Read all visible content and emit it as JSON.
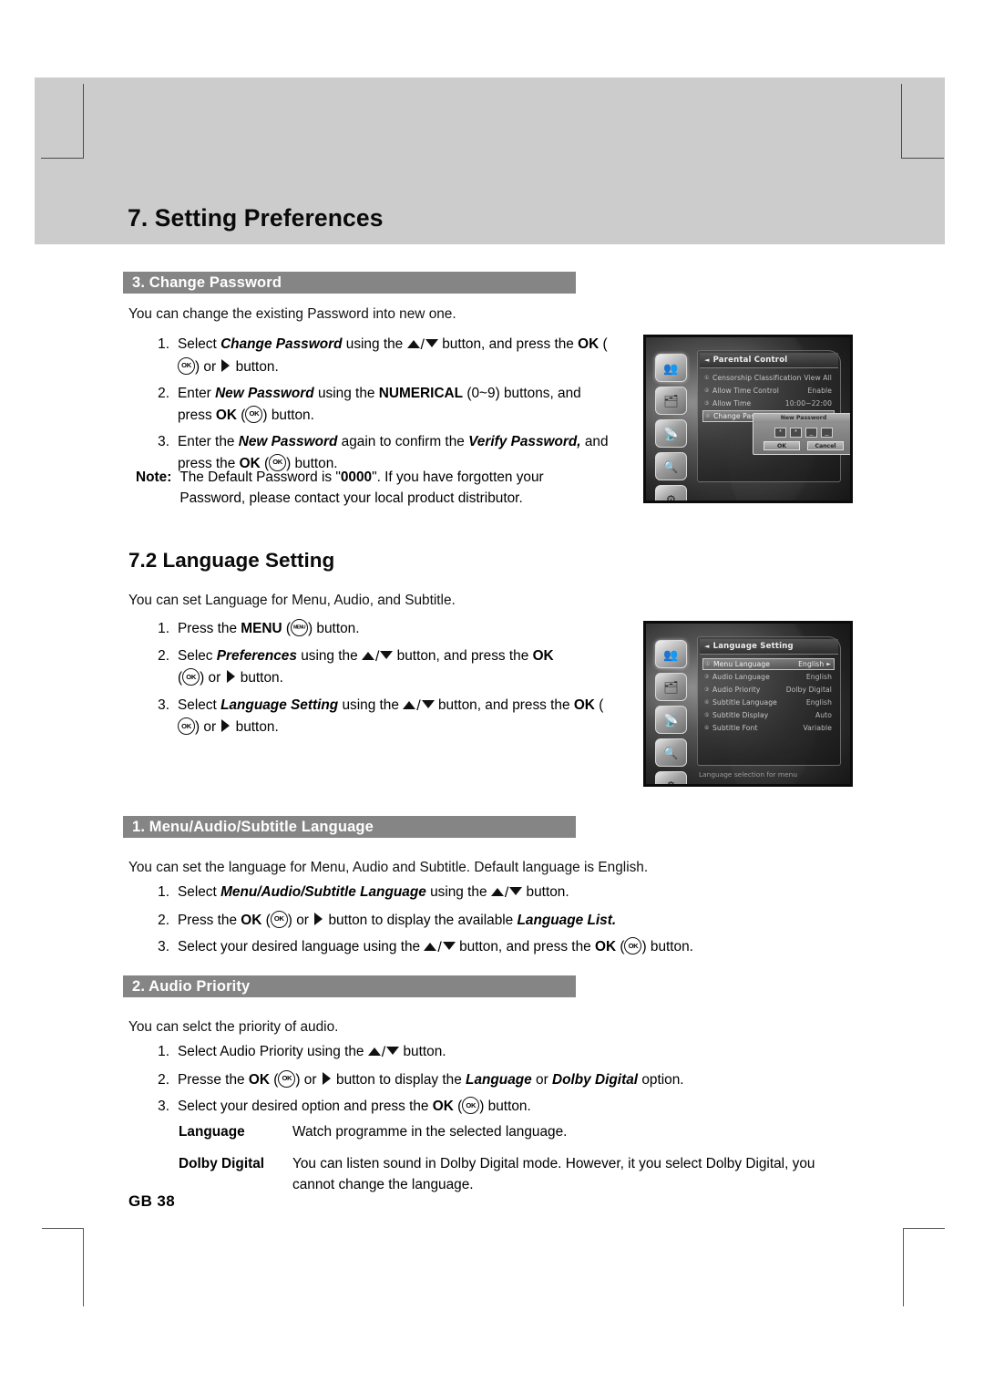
{
  "chapter": {
    "title": "7. Setting Preferences"
  },
  "footer": {
    "page": "GB 38"
  },
  "section_change_password": {
    "bar_label": "3. Change Password",
    "intro": "You can change the existing Password into new one.",
    "steps": [
      {
        "num": "1."
      },
      {
        "num": "2."
      },
      {
        "num": "3."
      }
    ],
    "step1_a": "Select ",
    "step1_b": "Change Password",
    "step1_c": " using the ",
    "step1_d": " button, and press the ",
    "step1_e": "OK",
    "step1_f": " (",
    "step1_g": ") or ",
    "step1_h": " button.",
    "step2_a": "Enter ",
    "step2_b": "New Password",
    "step2_c": " using the ",
    "step2_d": "NUMERICAL",
    "step2_e": " (0~9) buttons, and press ",
    "step2_f": "OK",
    "step2_g": " (",
    "step2_h": ") button.",
    "step3_a": "Enter the ",
    "step3_b": "New Password",
    "step3_c": " again to confirm the ",
    "step3_d": "Verify Password,",
    "step3_e": " and press the ",
    "step3_f": "OK",
    "step3_g": " (",
    "step3_h": ") button.",
    "note_label": "Note:",
    "note_a": "The Default Password is \"",
    "note_b": "0000",
    "note_c": "\". If you have forgotten your Password, please contact your local product distributor."
  },
  "section_language_setting": {
    "heading": "7.2 Language Setting",
    "intro": "You can set Language for Menu, Audio, and Subtitle.",
    "steps": [
      {
        "num": "1."
      },
      {
        "num": "2."
      },
      {
        "num": "3."
      }
    ],
    "step1_a": "Press the ",
    "step1_b": "MENU",
    "step1_c": " (",
    "step1_d": ") button.",
    "step2_a": "Selec ",
    "step2_b": "Preferences",
    "step2_c": " using the ",
    "step2_d": " button, and press the ",
    "step2_e": "OK",
    "step2_f": " (",
    "step2_g": ") or ",
    "step2_h": " button.",
    "step3_a": "Select ",
    "step3_b": "Language Setting",
    "step3_c": " using the ",
    "step3_d": " button, and press the ",
    "step3_e": "OK",
    "step3_f": " (",
    "step3_g": ") or ",
    "step3_h": " button."
  },
  "section_menu_audio_subtitle": {
    "bar_label": "1. Menu/Audio/Subtitle Language",
    "intro": "You can set the language for Menu, Audio and Subtitle. Default language is English.",
    "steps": [
      {
        "num": "1."
      },
      {
        "num": "2."
      },
      {
        "num": "3."
      }
    ],
    "step1_a": "Select ",
    "step1_b": "Menu/Audio/Subtitle Language",
    "step1_c": " using the ",
    "step1_d": " button.",
    "step2_a": "Press the ",
    "step2_b": "OK",
    "step2_c": " (",
    "step2_d": ") or ",
    "step2_e": " button to display the available ",
    "step2_f": "Language List.",
    "step3_a": "Select your desired language using the ",
    "step3_b": " button, and press the ",
    "step3_c": "OK",
    "step3_d": " (",
    "step3_e": ") button."
  },
  "section_audio_priority": {
    "bar_label": "2. Audio Priority",
    "intro": "You can selct the priority of audio.",
    "steps": [
      {
        "num": "1."
      },
      {
        "num": "2."
      },
      {
        "num": "3."
      }
    ],
    "step1_a": "Select Audio Priority using the ",
    "step1_b": " button.",
    "step2_a": "Presse the ",
    "step2_b": "OK",
    "step2_c": " (",
    "step2_d": ") or ",
    "step2_e": " button to display the ",
    "step2_f": "Language",
    "step2_g": " or ",
    "step2_h": "Dolby Digital",
    "step2_i": " option.",
    "step3_a": "Select your desired option and press the ",
    "step3_b": "OK",
    "step3_c": " (",
    "step3_d": ") button.",
    "definitions": [
      {
        "term": "Language",
        "desc": "Watch programme in the selected language."
      },
      {
        "term": "Dolby Digital",
        "desc": "You can listen sound in Dolby Digital mode. However, it you select Dolby Digital, you cannot change the language."
      }
    ]
  },
  "screenshot_parental_control": {
    "panel_title": "Parental Control",
    "back_arrow": "◄",
    "rows": [
      {
        "num": "①",
        "label": "Censorship Classification",
        "value": "View All"
      },
      {
        "num": "②",
        "label": "Allow Time Control",
        "value": "Enable"
      },
      {
        "num": "③",
        "label": "Allow Time",
        "value": "10:00~22:00"
      },
      {
        "num": "④",
        "label": "Change Password",
        "value": ""
      }
    ],
    "sidebar_icons": [
      "parental-control-icon",
      "installation-icon",
      "antenna-icon",
      "channel-search-icon",
      "system-icon"
    ],
    "dialog": {
      "title": "New Password",
      "digits": [
        "*",
        "*",
        "_",
        "_"
      ],
      "ok_label": "OK",
      "cancel_label": "Cancel"
    }
  },
  "screenshot_language_setting": {
    "panel_title": "Language Setting",
    "back_arrow": "◄",
    "rows": [
      {
        "num": "①",
        "label": "Menu Language",
        "value": "English",
        "selected": true,
        "arrow": "►"
      },
      {
        "num": "②",
        "label": "Audio Language",
        "value": "English",
        "selected": false,
        "arrow": ""
      },
      {
        "num": "③",
        "label": "Audio Priority",
        "value": "Dolby Digital",
        "selected": false,
        "arrow": ""
      },
      {
        "num": "④",
        "label": "Subtitle Language",
        "value": "English",
        "selected": false,
        "arrow": ""
      },
      {
        "num": "⑤",
        "label": "Subtitle Display",
        "value": "Auto",
        "selected": false,
        "arrow": ""
      },
      {
        "num": "⑥",
        "label": "Subtitle Font",
        "value": "Variable",
        "selected": false,
        "arrow": ""
      }
    ],
    "sidebar_icons": [
      "parental-control-icon",
      "installation-icon",
      "antenna-icon",
      "channel-search-icon",
      "system-icon"
    ],
    "status_text": "Language selection for menu"
  },
  "colors": {
    "band_grey": "#cccccc",
    "section_bar_grey": "#858585",
    "text_black": "#111111"
  }
}
